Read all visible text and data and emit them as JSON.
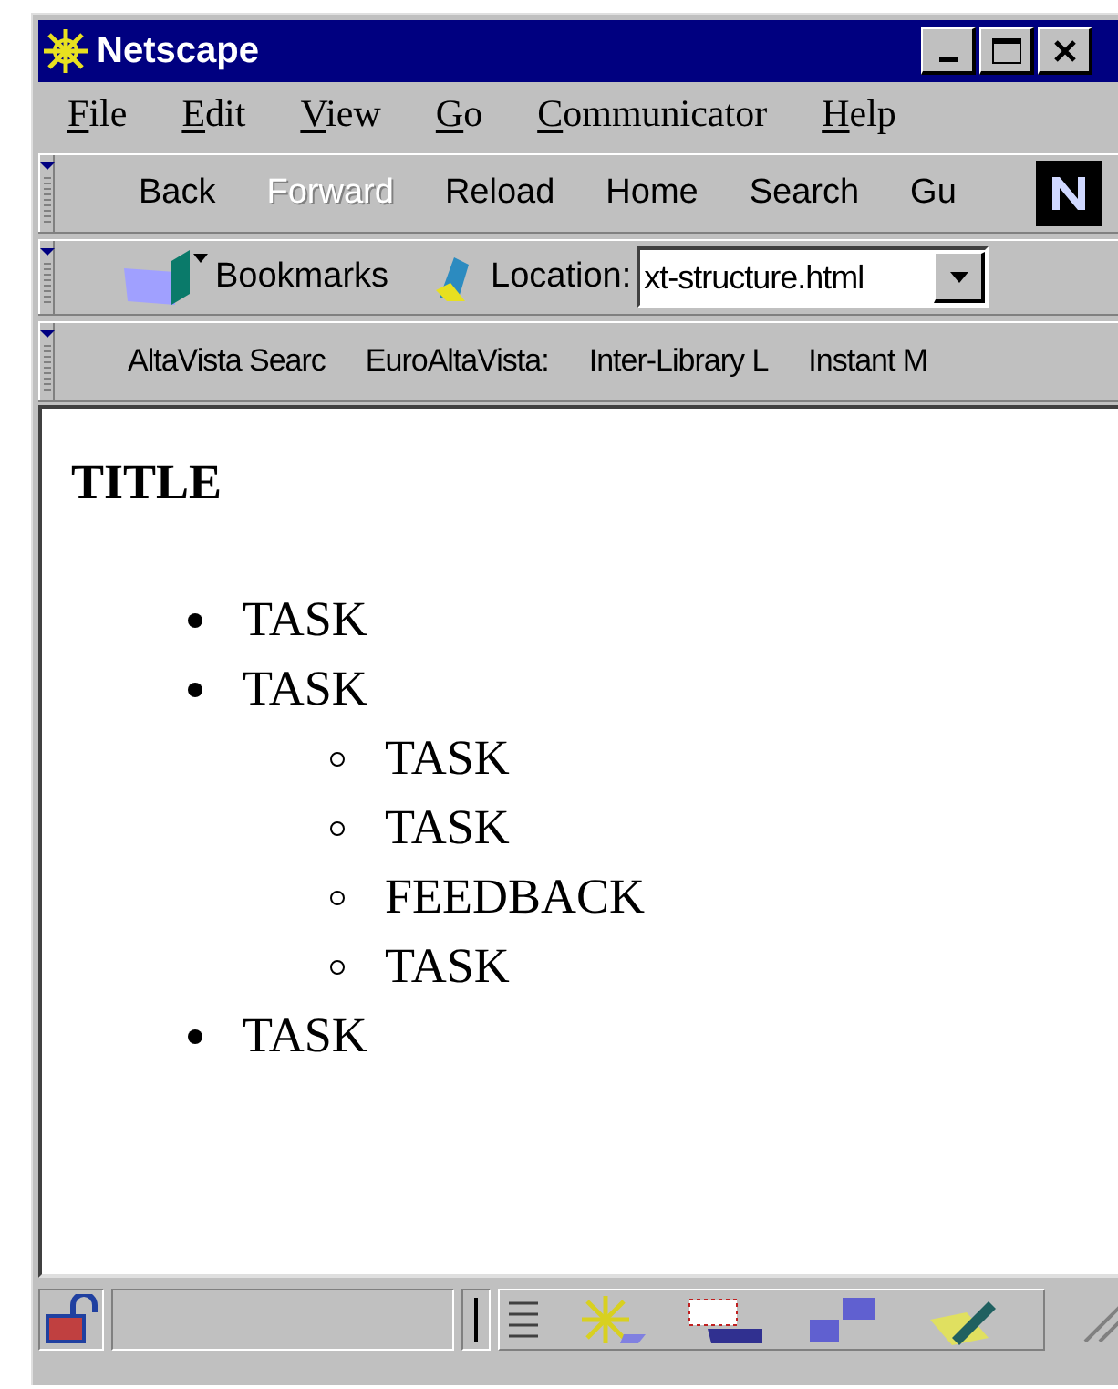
{
  "window": {
    "title": "Netscape"
  },
  "menu": [
    "File",
    "Edit",
    "View",
    "Go",
    "Communicator",
    "Help"
  ],
  "navigation_toolbar": [
    {
      "label": "Back",
      "disabled": false
    },
    {
      "label": "Forward",
      "disabled": true
    },
    {
      "label": "Reload",
      "disabled": false
    },
    {
      "label": "Home",
      "disabled": false
    },
    {
      "label": "Search",
      "disabled": false
    },
    {
      "label": "Gu",
      "disabled": false
    }
  ],
  "location_toolbar": {
    "bookmarks": "Bookmarks",
    "location_label": "Location:",
    "location_value": "xt-structure.html"
  },
  "personal_toolbar": [
    "AltaVista Searc",
    "EuroAltaVista:",
    "Inter-Library L",
    "Instant M"
  ],
  "page": {
    "title": "TITLE",
    "items": [
      {
        "text": "TASK"
      },
      {
        "text": "TASK",
        "children": [
          {
            "text": "TASK"
          },
          {
            "text": "TASK"
          },
          {
            "text": "FEEDBACK"
          },
          {
            "text": "TASK"
          }
        ]
      },
      {
        "text": "TASK"
      }
    ]
  }
}
